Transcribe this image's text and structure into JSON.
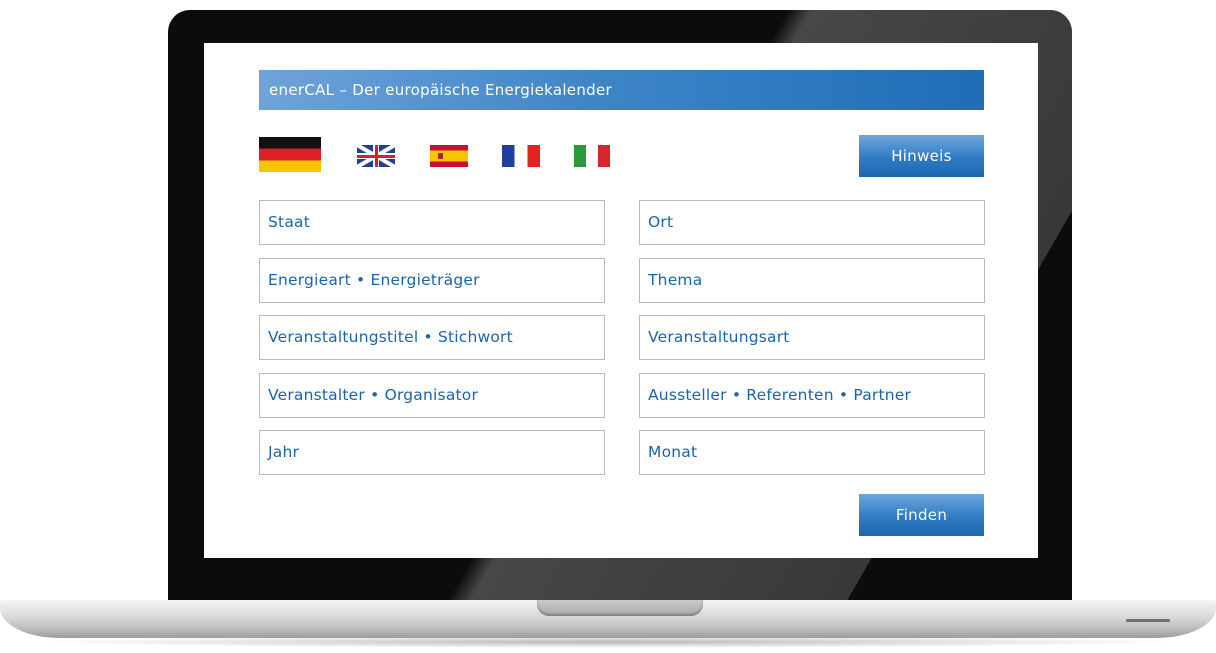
{
  "header": {
    "title": "enerCAL – Der europäische Energiekalender"
  },
  "languages": [
    "de-flag-icon",
    "gb-flag-icon",
    "es-flag-icon",
    "fr-flag-icon",
    "it-flag-icon"
  ],
  "buttons": {
    "hinweis": "Hinweis",
    "finden": "Finden"
  },
  "fields": {
    "staat": "Staat",
    "ort": "Ort",
    "energieart": "Energieart • Energieträger",
    "thema": "Thema",
    "veranstaltungstitel": "Veranstaltungstitel • Stichwort",
    "veranstaltungsart": "Veranstaltungsart",
    "veranstalter": "Veranstalter • Organisator",
    "aussteller": "Aussteller • Referenten • Partner",
    "jahr": "Jahr",
    "monat": "Monat"
  },
  "colors": {
    "accent": "#2f7cc4",
    "field_text": "#1b64ab",
    "field_border": "#b9b9b9"
  }
}
